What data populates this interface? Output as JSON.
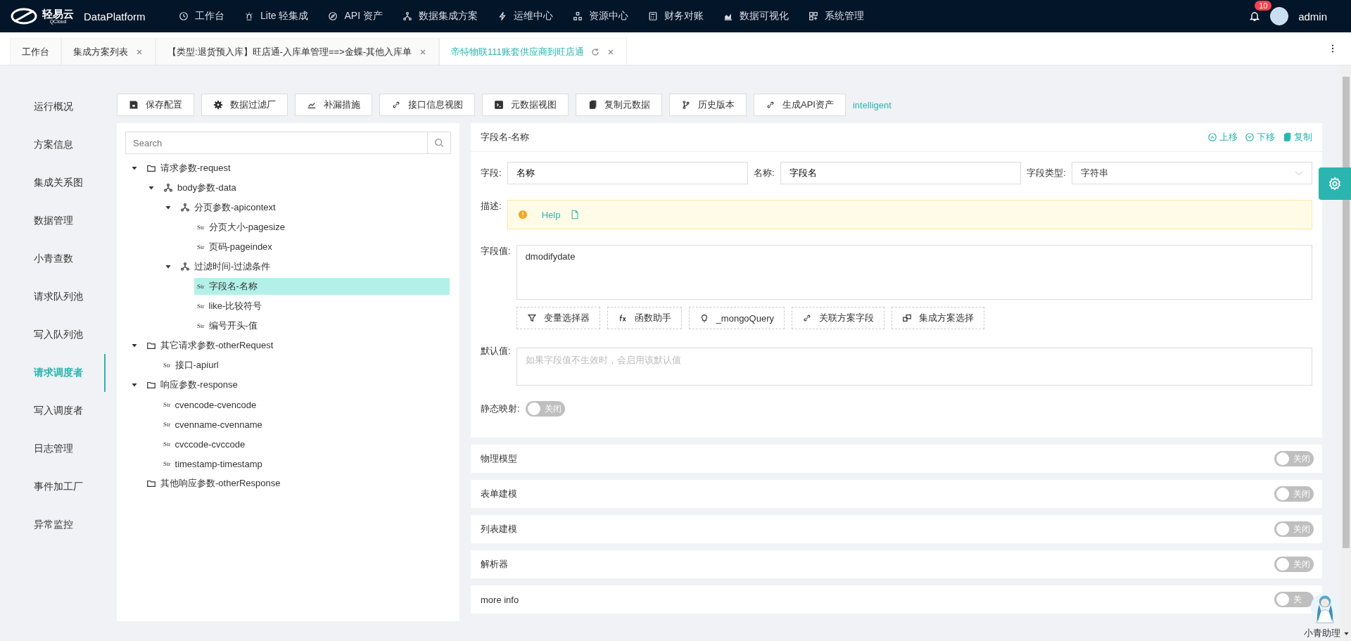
{
  "brand": {
    "logo": "轻易云",
    "logo_sub": "QCloud",
    "name": "DataPlatform"
  },
  "nav": [
    {
      "label": "工作台"
    },
    {
      "label": "Lite 轻集成"
    },
    {
      "label": "API 资产"
    },
    {
      "label": "数据集成方案"
    },
    {
      "label": "运维中心"
    },
    {
      "label": "资源中心"
    },
    {
      "label": "财务对账"
    },
    {
      "label": "数据可视化"
    },
    {
      "label": "系统管理"
    }
  ],
  "user": {
    "badge": "10",
    "name": "admin"
  },
  "tabs": [
    {
      "label": "工作台",
      "selected": false,
      "closable": false
    },
    {
      "label": "集成方案列表",
      "selected": false,
      "closable": true
    },
    {
      "label": "【类型:退货预入库】旺店通-入库单管理==>金蝶-其他入库单",
      "selected": false,
      "closable": true
    },
    {
      "label": "帝特物联111账套供应商到旺店通",
      "selected": true,
      "closable": true
    }
  ],
  "sidebar": {
    "items": [
      {
        "label": "运行概况",
        "selected": false
      },
      {
        "label": "方案信息",
        "selected": false
      },
      {
        "label": "集成关系图",
        "selected": false
      },
      {
        "label": "数据管理",
        "selected": false
      },
      {
        "label": "小青查数",
        "selected": false
      },
      {
        "label": "请求队列池",
        "selected": false
      },
      {
        "label": "写入队列池",
        "selected": false
      },
      {
        "label": "请求调度者",
        "selected": true
      },
      {
        "label": "写入调度者",
        "selected": false
      },
      {
        "label": "日志管理",
        "selected": false
      },
      {
        "label": "事件加工厂",
        "selected": false
      },
      {
        "label": "异常监控",
        "selected": false
      }
    ]
  },
  "toolbar": {
    "buttons": [
      "保存配置",
      "数据过滤厂",
      "补漏措施",
      "接口信息视图",
      "元数据视图",
      "复制元数据",
      "历史版本",
      "生成API资产"
    ],
    "link": "intelligent"
  },
  "tree": {
    "search": {
      "placeholder": "Search"
    },
    "nodes": [
      {
        "kind": "folder",
        "label": "请求参数-request",
        "expanded": true,
        "selected": false,
        "children": [
          {
            "kind": "object",
            "label": "body参数-data",
            "expanded": true,
            "selected": false,
            "children": [
              {
                "kind": "object",
                "label": "分页参数-apicontext",
                "expanded": true,
                "selected": false,
                "children": [
                  {
                    "kind": "string",
                    "tag": "Str",
                    "label": "分页大小-pagesize",
                    "selected": false
                  },
                  {
                    "kind": "string",
                    "tag": "Str",
                    "label": "页码-pageindex",
                    "selected": false
                  }
                ]
              },
              {
                "kind": "object",
                "label": "过滤时间-过滤条件",
                "expanded": true,
                "selected": false,
                "children": [
                  {
                    "kind": "string",
                    "tag": "Str",
                    "label": "字段名-名称",
                    "selected": true
                  },
                  {
                    "kind": "string",
                    "tag": "Str",
                    "label": "like-比较符号",
                    "selected": false
                  },
                  {
                    "kind": "string",
                    "tag": "Str",
                    "label": "编号开头-值",
                    "selected": false
                  }
                ]
              }
            ]
          }
        ]
      },
      {
        "kind": "folder",
        "label": "其它请求参数-otherRequest",
        "expanded": true,
        "selected": false,
        "children": [
          {
            "kind": "string",
            "tag": "Str",
            "label": "接口-apiurl",
            "selected": false
          }
        ]
      },
      {
        "kind": "folder",
        "label": "响应参数-response",
        "expanded": true,
        "selected": false,
        "children": [
          {
            "kind": "string",
            "tag": "Str",
            "label": "cvencode-cvencode",
            "selected": false
          },
          {
            "kind": "string",
            "tag": "Str",
            "label": "cvenname-cvenname",
            "selected": false
          },
          {
            "kind": "string",
            "tag": "Str",
            "label": "cvccode-cvccode",
            "selected": false
          },
          {
            "kind": "string",
            "tag": "Str",
            "label": "timestamp-timestamp",
            "selected": false
          }
        ]
      },
      {
        "kind": "folder",
        "label": "其他响应参数-otherResponse",
        "selected": false
      }
    ]
  },
  "editor": {
    "title": "字段名-名称",
    "actions": [
      "上移",
      "下移",
      "复制"
    ],
    "field": {
      "label": "字段:",
      "value": "名称"
    },
    "name": {
      "label": "名称:",
      "value": "字段名"
    },
    "type": {
      "label": "字段类型:",
      "value": "字符串"
    },
    "description": {
      "label": "描述:",
      "help": "Help"
    },
    "value": {
      "label": "字段值:",
      "value": "dmodifydate"
    },
    "tools": [
      "变量选择器",
      "函数助手",
      "_mongoQuery",
      "关联方案字段",
      "集成方案选择"
    ],
    "default": {
      "label": "默认值:",
      "placeholder": "如果字段值不生效时，会启用该默认值"
    },
    "static_mapping": {
      "label": "静态映射:",
      "on": false,
      "switch_label": "关闭"
    }
  },
  "panels": [
    {
      "title": "物理模型",
      "on": false,
      "switch_label": "关闭"
    },
    {
      "title": "表单建模",
      "on": false,
      "switch_label": "关闭"
    },
    {
      "title": "列表建模",
      "on": false,
      "switch_label": "关闭"
    },
    {
      "title": "解析器",
      "on": false,
      "switch_label": "关闭"
    },
    {
      "title": "more info",
      "on": false,
      "switch_label": "关"
    }
  ],
  "assistant": {
    "label": "小青助理"
  }
}
